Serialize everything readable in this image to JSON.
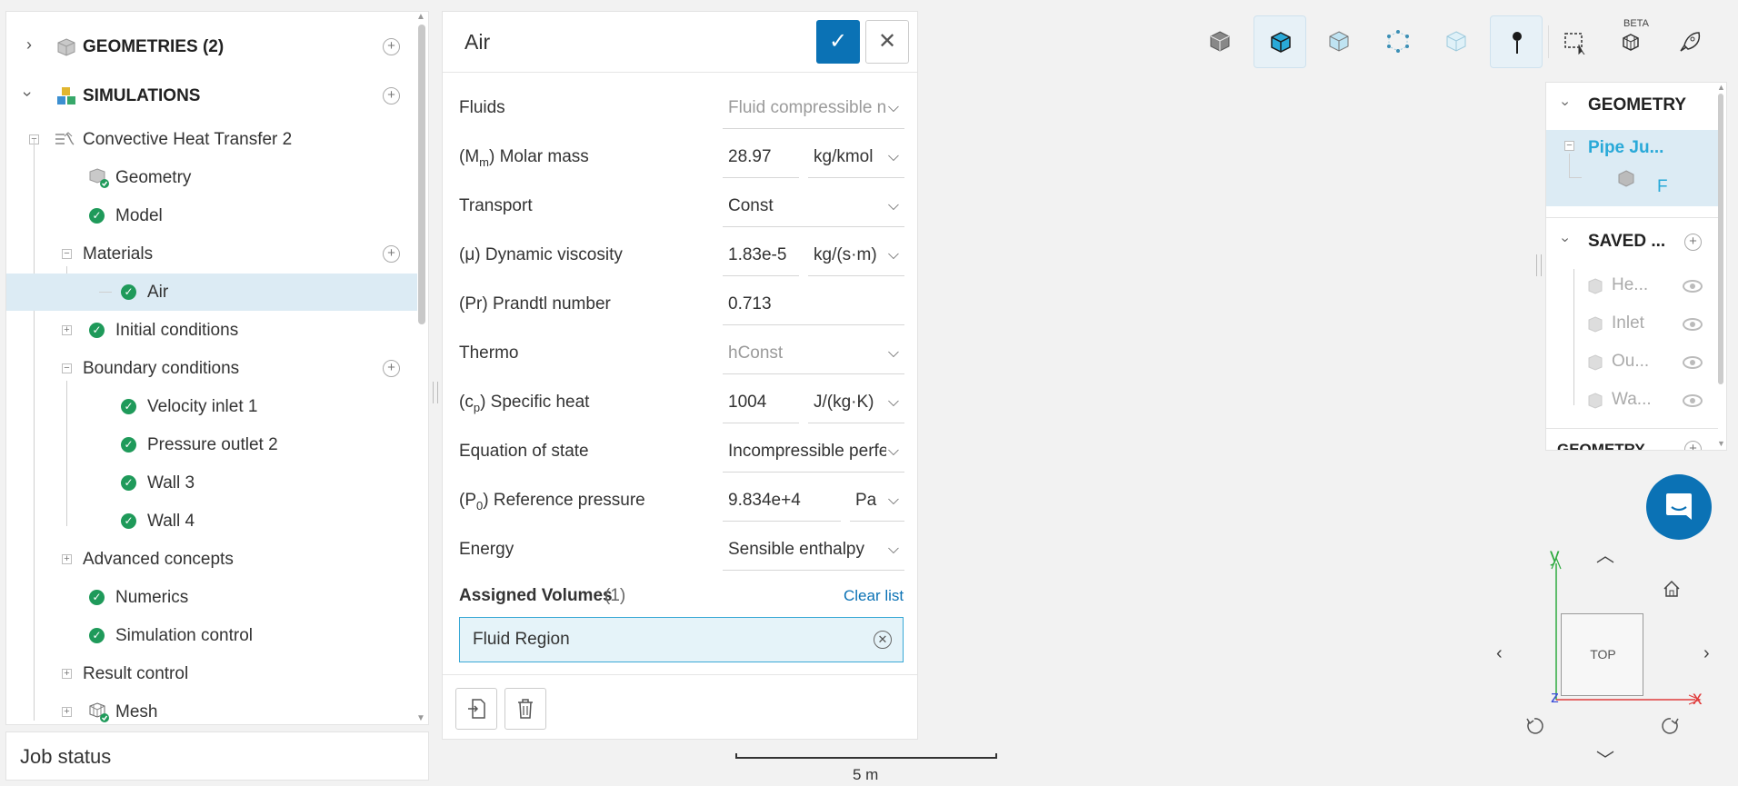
{
  "tree": {
    "geometries_label": "GEOMETRIES (2)",
    "simulations_label": "SIMULATIONS",
    "sim_name": "Convective Heat Transfer 2",
    "geometry": "Geometry",
    "model": "Model",
    "materials": "Materials",
    "air": "Air",
    "initial_conditions": "Initial conditions",
    "boundary_conditions": "Boundary conditions",
    "velocity_inlet": "Velocity inlet 1",
    "pressure_outlet": "Pressure outlet 2",
    "wall3": "Wall 3",
    "wall4": "Wall 4",
    "advanced_concepts": "Advanced concepts",
    "numerics": "Numerics",
    "simulation_control": "Simulation control",
    "result_control": "Result control",
    "mesh": "Mesh"
  },
  "job_status": "Job status",
  "material": {
    "title": "Air",
    "fluids_label": "Fluids",
    "fluids_value": "Fluid compressible n",
    "molar_mass_sym": "M",
    "molar_mass_sub": "m",
    "molar_mass_label": "Molar mass",
    "molar_mass_value": "28.97",
    "molar_mass_unit": "kg/kmol",
    "transport_label": "Transport",
    "transport_value": "Const",
    "viscosity_sym": "(μ)",
    "viscosity_label": "Dynamic viscosity",
    "viscosity_value": "1.83e-5",
    "viscosity_unit": "kg/(s·m)",
    "prandtl_sym": "(Pr)",
    "prandtl_label": "Prandtl number",
    "prandtl_value": "0.713",
    "thermo_label": "Thermo",
    "thermo_value": "hConst",
    "cp_sym": "c",
    "cp_sub": "p",
    "cp_label": "Specific heat",
    "cp_value": "1004",
    "cp_unit": "J/(kg·K)",
    "eos_label": "Equation of state",
    "eos_value": "Incompressible perfe",
    "p0_sym": "P",
    "p0_sub": "0",
    "p0_label": "Reference pressure",
    "p0_value": "9.834e+4",
    "p0_unit": "Pa",
    "energy_label": "Energy",
    "energy_value": "Sensible enthalpy",
    "assigned_title": "Assigned Volumes",
    "assigned_count": "(1)",
    "clear_list": "Clear list",
    "fluid_region": "Fluid Region"
  },
  "toolbar": {
    "beta": "BETA"
  },
  "right_panel": {
    "geometry_title": "GEOMETRY",
    "pipe_item": "Pipe Ju...",
    "f_item": "F",
    "saved_title": "SAVED ...",
    "saved_items": [
      "He...",
      "Inlet",
      "Ou...",
      "Wa..."
    ],
    "geometry_title_2": "GEOMETRY"
  },
  "scale": {
    "label": "5 m"
  },
  "view_cube": {
    "face": "TOP",
    "axis_x": "x",
    "axis_y": "y",
    "axis_z": "z"
  },
  "colors": {
    "accent": "#0b72b5",
    "success": "#1f9a5a",
    "highlight": "#dcebf4"
  }
}
